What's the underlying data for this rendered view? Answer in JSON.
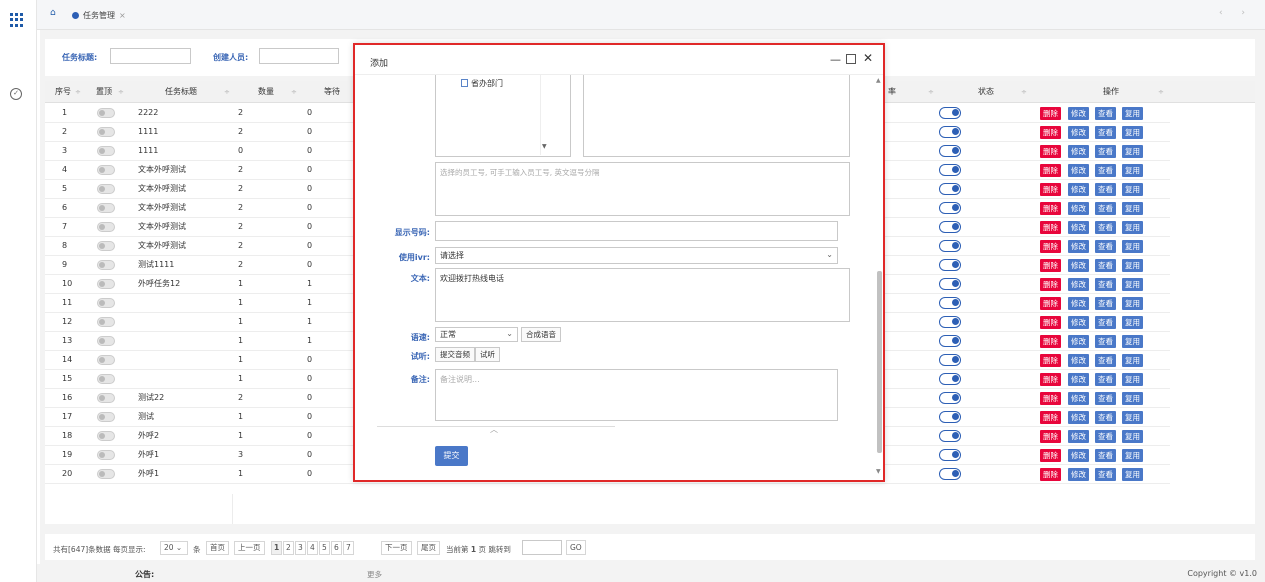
{
  "app": {
    "tab_label": "任务管理",
    "tab_close": "×",
    "nav_arrows": "‹ ›"
  },
  "search": {
    "title_label": "任务标题:",
    "creator_label": "创建人员:"
  },
  "table": {
    "headers": {
      "seq": "序号",
      "top": "置顶",
      "title": "任务标题",
      "count": "数量",
      "wait": "等待",
      "rate": "率",
      "status": "状态",
      "ops": "操作"
    },
    "sort_glyph": "÷",
    "actions": {
      "delete": "删除",
      "modify": "修改",
      "view": "查看",
      "reuse": "复用"
    },
    "rows": [
      {
        "seq": "1",
        "title": "2222",
        "count": "2",
        "wait": "0"
      },
      {
        "seq": "2",
        "title": "1111",
        "count": "2",
        "wait": "0"
      },
      {
        "seq": "3",
        "title": "1111",
        "count": "0",
        "wait": "0"
      },
      {
        "seq": "4",
        "title": "文本外呼测试",
        "count": "2",
        "wait": "0"
      },
      {
        "seq": "5",
        "title": "文本外呼测试",
        "count": "2",
        "wait": "0"
      },
      {
        "seq": "6",
        "title": "文本外呼测试",
        "count": "2",
        "wait": "0"
      },
      {
        "seq": "7",
        "title": "文本外呼测试",
        "count": "2",
        "wait": "0"
      },
      {
        "seq": "8",
        "title": "文本外呼测试",
        "count": "2",
        "wait": "0"
      },
      {
        "seq": "9",
        "title": "测试1111",
        "count": "2",
        "wait": "0"
      },
      {
        "seq": "10",
        "title": "外呼任务12",
        "count": "1",
        "wait": "1"
      },
      {
        "seq": "11",
        "title": "",
        "count": "1",
        "wait": "1"
      },
      {
        "seq": "12",
        "title": "",
        "count": "1",
        "wait": "1"
      },
      {
        "seq": "13",
        "title": "",
        "count": "1",
        "wait": "1"
      },
      {
        "seq": "14",
        "title": "",
        "count": "1",
        "wait": "0"
      },
      {
        "seq": "15",
        "title": "",
        "count": "1",
        "wait": "0"
      },
      {
        "seq": "16",
        "title": "测试22",
        "count": "2",
        "wait": "0"
      },
      {
        "seq": "17",
        "title": "测试",
        "count": "1",
        "wait": "0"
      },
      {
        "seq": "18",
        "title": "外呼2",
        "count": "1",
        "wait": "0"
      },
      {
        "seq": "19",
        "title": "外呼1",
        "count": "3",
        "wait": "0"
      },
      {
        "seq": "20",
        "title": "外呼1",
        "count": "1",
        "wait": "0"
      }
    ]
  },
  "pager": {
    "total": "共有[647]条数据 每页显示:",
    "page_size": "20",
    "unit": "条",
    "first": "首页",
    "prev": "上一页",
    "pages": [
      "1",
      "2",
      "3",
      "4",
      "5",
      "6",
      "7"
    ],
    "next": "下一页",
    "last": "尾页",
    "current_prefix": "当前第",
    "current": "1",
    "current_suffix": "页 跳转到",
    "go": "GO"
  },
  "footer": {
    "notice_label": "公告:",
    "more": "更多",
    "copyright": "Copyright © v1.0"
  },
  "modal": {
    "title": "添加",
    "tree_item": "省办部门",
    "staff_placeholder": "选择的员工号, 可手工输入员工号, 英文逗号分隔",
    "display_number_label": "显示号码:",
    "ivr_label": "使用ivr:",
    "ivr_value": "请选择",
    "text_label": "文本:",
    "text_value": "欢迎拨打热线电话",
    "speed_label": "语速:",
    "speed_value": "正常",
    "synth_button": "合成语音",
    "listen_label": "试听:",
    "upload_button": "提交音频",
    "listen_button": "试听",
    "remark_label": "备注:",
    "remark_placeholder": "备注说明...",
    "submit": "提交"
  }
}
